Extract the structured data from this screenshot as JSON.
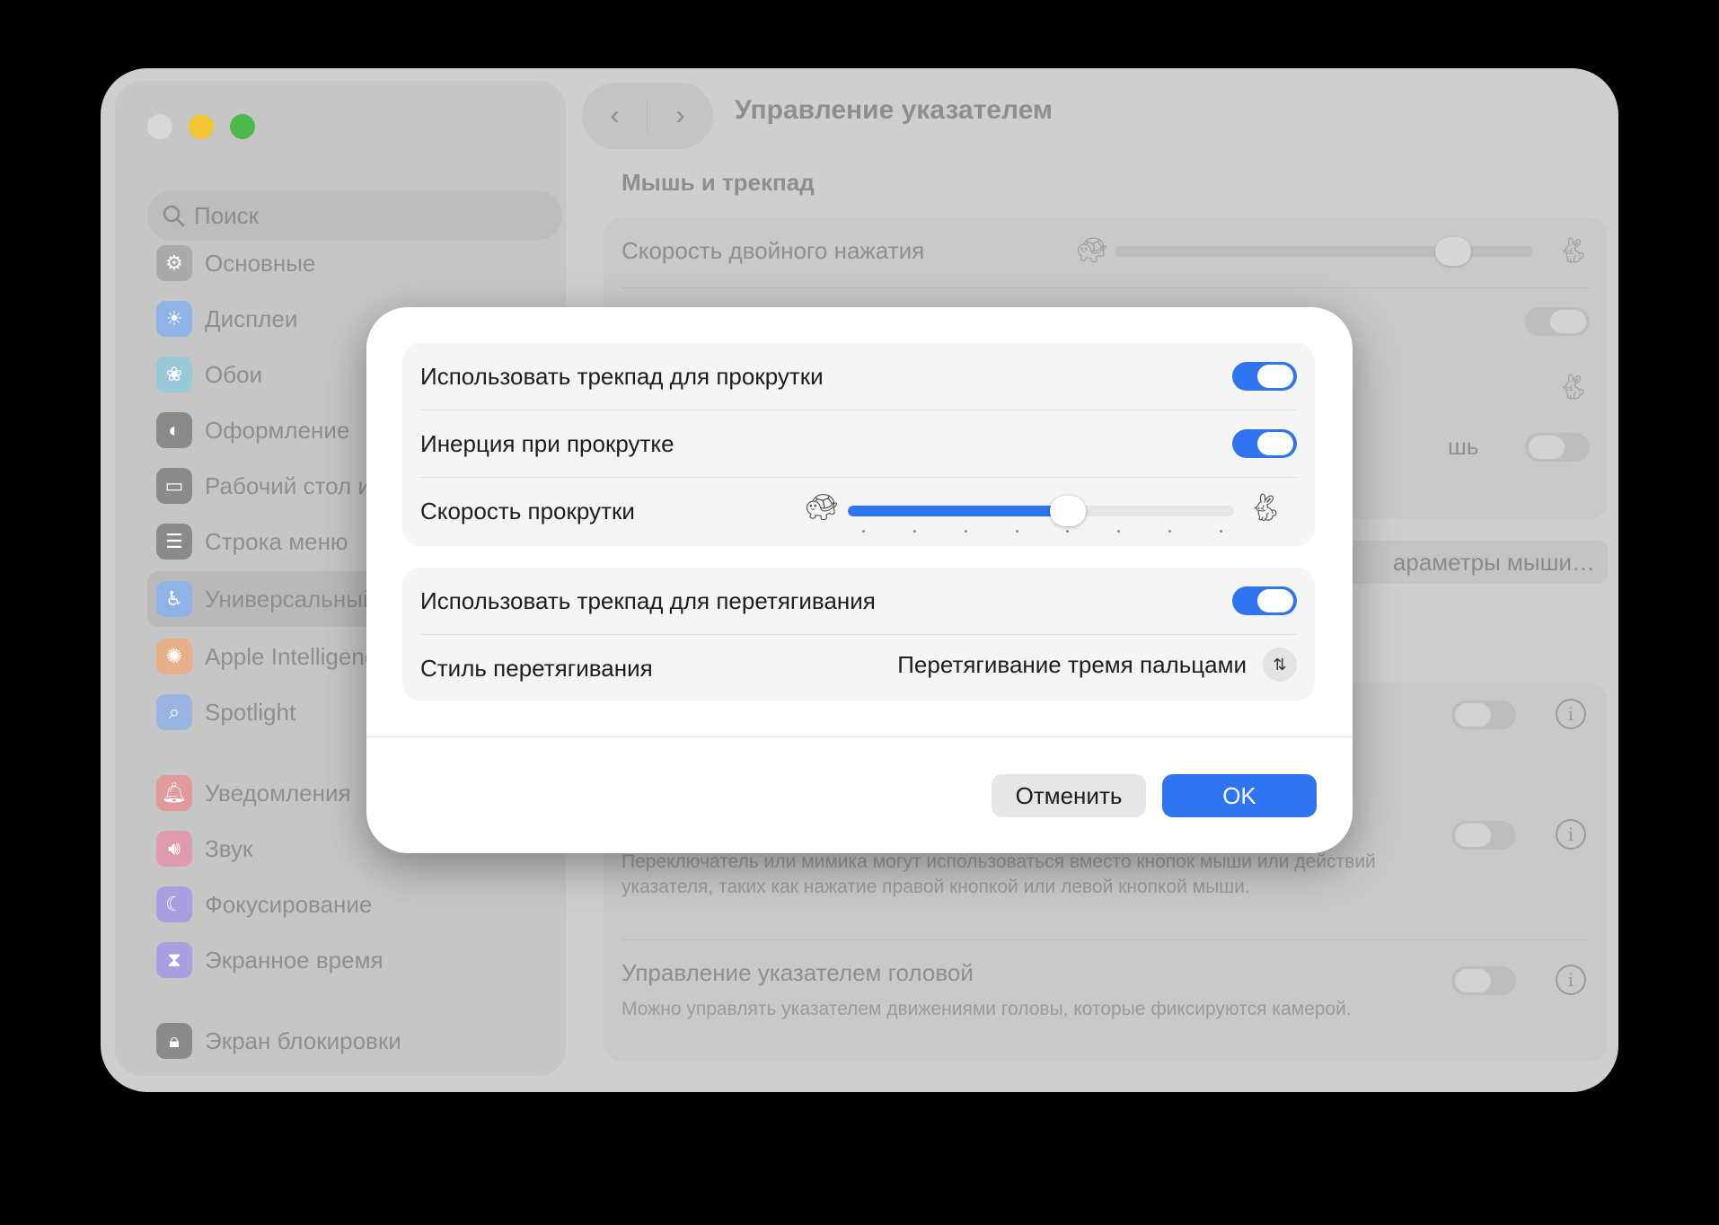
{
  "window": {
    "title": "Управление указателем",
    "section_header": "Мышь и трекпад"
  },
  "search": {
    "placeholder": "Поиск"
  },
  "sidebar": {
    "items": [
      {
        "label": "Основные",
        "icon": "gear-icon",
        "color": "#8e8e93"
      },
      {
        "label": "Дисплеи",
        "icon": "sun-icon",
        "color": "#3a82f7"
      },
      {
        "label": "Обои",
        "icon": "flower-icon",
        "color": "#3fbcd6"
      },
      {
        "label": "Оформление",
        "icon": "appearance-icon",
        "color": "#1d1d1f"
      },
      {
        "label": "Рабочий стол и",
        "icon": "desktop-icon",
        "color": "#1d1d1f"
      },
      {
        "label": "Строка меню",
        "icon": "menubar-icon",
        "color": "#1d1d1f"
      },
      {
        "label": "Универсальный",
        "icon": "accessibility-icon",
        "color": "#3a82f7",
        "active": true
      },
      {
        "label": "Apple Intelligenc",
        "icon": "apple-intelligence-icon",
        "color": "#f28a30"
      },
      {
        "label": "Spotlight",
        "icon": "magnifier-icon",
        "color": "#5b8def"
      },
      {
        "label": "Уведомления",
        "icon": "bell-icon",
        "color": "#e64b4b"
      },
      {
        "label": "Звук",
        "icon": "speaker-icon",
        "color": "#e64b72"
      },
      {
        "label": "Фокусирование",
        "icon": "moon-icon",
        "color": "#6b5bd6"
      },
      {
        "label": "Экранное время",
        "icon": "hourglass-icon",
        "color": "#6b5bd6"
      },
      {
        "label": "Экран блокировки",
        "icon": "lock-icon",
        "color": "#1d1d1f"
      }
    ]
  },
  "background": {
    "double_click_label": "Скорость двойного нажатия",
    "mouse_partial_label": "шь",
    "mouse_options_button": "араметры мыши…",
    "switch_desc": "Переключатель или мимика могут использоваться вместо кнопок мыши или действий указателя, таких как нажатие правой кнопкой или левой кнопкой мыши.",
    "head_pointer_label": "Управление указателем головой",
    "head_pointer_desc": "Можно управлять указателем движениями головы, которые фиксируются камерой."
  },
  "dialog": {
    "scroll_label": "Использовать трекпад для прокрутки",
    "scroll_on": true,
    "inertia_label": "Инерция при прокрутке",
    "inertia_on": true,
    "scroll_speed_label": "Скорость прокрутки",
    "scroll_speed_value": 0.57,
    "drag_label": "Использовать трекпад для перетягивания",
    "drag_on": true,
    "drag_style_label": "Стиль перетягивания",
    "drag_style_value": "Перетягивание тремя пальцами",
    "cancel_label": "Отменить",
    "ok_label": "OK"
  },
  "colors": {
    "accent": "#2f74f0"
  }
}
